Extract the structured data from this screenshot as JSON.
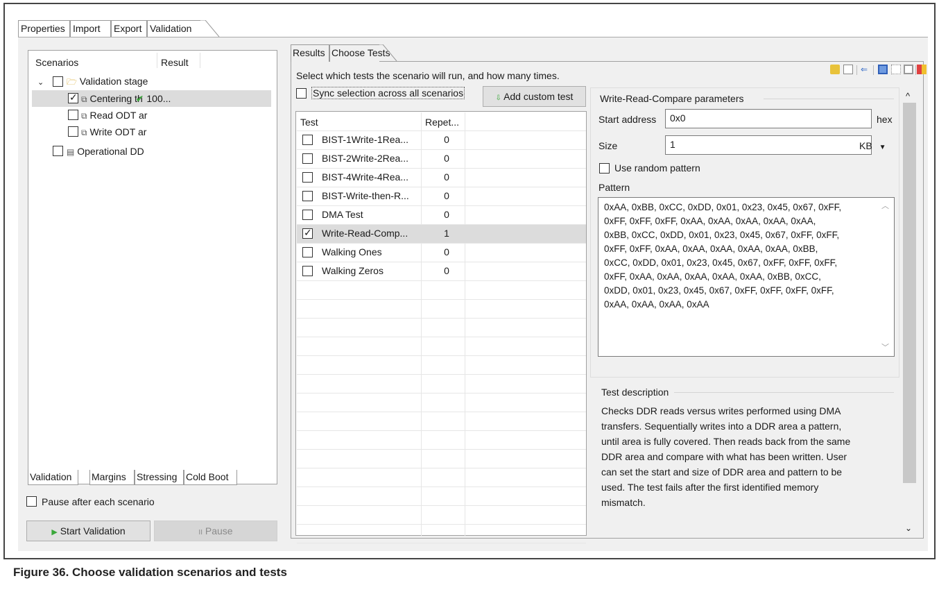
{
  "top_tabs": [
    "Properties",
    "Import",
    "Export",
    "Validation"
  ],
  "tree": {
    "col_scenarios": "Scenarios",
    "col_result": "Result",
    "items": [
      {
        "label": "Validation stage",
        "checked": false,
        "result": ""
      },
      {
        "label": "Centering th",
        "checked": true,
        "result": "100..."
      },
      {
        "label": "Read ODT ar",
        "checked": false,
        "result": ""
      },
      {
        "label": "Write ODT ar",
        "checked": false,
        "result": ""
      },
      {
        "label": "Operational DD",
        "checked": false,
        "result": ""
      }
    ]
  },
  "left_bottom_tabs": [
    "Validation",
    "Margins",
    "Stressing",
    "Cold Boot"
  ],
  "pause_checkbox_label": "Pause after each scenario",
  "start_button": "Start Validation",
  "pause_button": "Pause",
  "right_tabs": [
    "Results",
    "Choose Tests"
  ],
  "instruction": "Select which tests the scenario will run, and how many times.",
  "sync_label": "Sync selection across all scenarios",
  "add_custom_label": "Add custom test",
  "table": {
    "col_test": "Test",
    "col_repeat": "Repet...",
    "rows": [
      {
        "name": "BIST-1Write-1Rea...",
        "rep": "0",
        "checked": false
      },
      {
        "name": "BIST-2Write-2Rea...",
        "rep": "0",
        "checked": false
      },
      {
        "name": "BIST-4Write-4Rea...",
        "rep": "0",
        "checked": false
      },
      {
        "name": "BIST-Write-then-R...",
        "rep": "0",
        "checked": false
      },
      {
        "name": "DMA Test",
        "rep": "0",
        "checked": false
      },
      {
        "name": "Write-Read-Comp...",
        "rep": "1",
        "checked": true
      },
      {
        "name": "Walking Ones",
        "rep": "0",
        "checked": false
      },
      {
        "name": "Walking Zeros",
        "rep": "0",
        "checked": false
      }
    ]
  },
  "params": {
    "title": "Write-Read-Compare parameters",
    "start_label": "Start address",
    "start_value": "0x0",
    "start_unit": "hex",
    "size_label": "Size",
    "size_value": "1",
    "size_unit": "KB",
    "random_label": "Use random pattern",
    "pattern_label": "Pattern",
    "pattern_lines": [
      "0xAA, 0xBB, 0xCC, 0xDD, 0x01, 0x23, 0x45, 0x67, 0xFF,",
      "0xFF, 0xFF, 0xFF, 0xAA, 0xAA, 0xAA, 0xAA, 0xAA,",
      "0xBB, 0xCC, 0xDD, 0x01, 0x23, 0x45, 0x67, 0xFF, 0xFF,",
      "0xFF, 0xFF, 0xAA, 0xAA, 0xAA, 0xAA, 0xAA, 0xBB,",
      "0xCC, 0xDD, 0x01, 0x23, 0x45, 0x67, 0xFF, 0xFF, 0xFF,",
      "0xFF, 0xAA, 0xAA, 0xAA, 0xAA, 0xAA, 0xBB, 0xCC,",
      "0xDD, 0x01, 0x23, 0x45, 0x67, 0xFF, 0xFF, 0xFF, 0xFF,",
      "0xAA, 0xAA, 0xAA, 0xAA"
    ]
  },
  "description": {
    "title": "Test description",
    "lines": [
      "Checks DDR reads versus writes performed using DMA",
      "transfers. Sequentially writes into a DDR area a pattern,",
      "until area is fully covered. Then reads back from the same",
      "DDR area and compare with what has been written. User",
      "can set the start and size of DDR area and pattern to be",
      "used. The test fails after the first identified memory",
      "mismatch."
    ]
  },
  "caption": "Figure 36.  Choose validation scenarios and tests",
  "colors": {
    "accent_green": "#3aa83a",
    "selection": "#dcdcdc",
    "panel_bg": "#f0f0f0"
  }
}
